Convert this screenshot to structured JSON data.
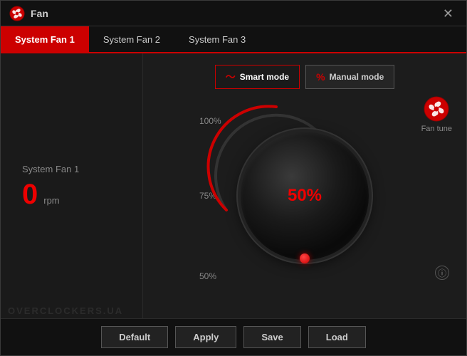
{
  "window": {
    "title": "Fan",
    "close_label": "✕"
  },
  "tabs": [
    {
      "label": "System Fan 1",
      "active": true
    },
    {
      "label": "System Fan 2",
      "active": false
    },
    {
      "label": "System Fan 3",
      "active": false
    }
  ],
  "left_panel": {
    "fan_name": "System Fan 1",
    "rpm_value": "0",
    "rpm_unit": "rpm"
  },
  "right_panel": {
    "mode_smart_label": "Smart mode",
    "mode_manual_label": "Manual mode",
    "knob_value": "50%",
    "scale_100": "100%",
    "scale_75": "75%",
    "scale_50": "50%",
    "fan_tune_label": "Fan tune"
  },
  "bottom_bar": {
    "default_label": "Default",
    "apply_label": "Apply",
    "save_label": "Save",
    "load_label": "Load"
  },
  "watermark": "OVERCLOCKERS.UA"
}
